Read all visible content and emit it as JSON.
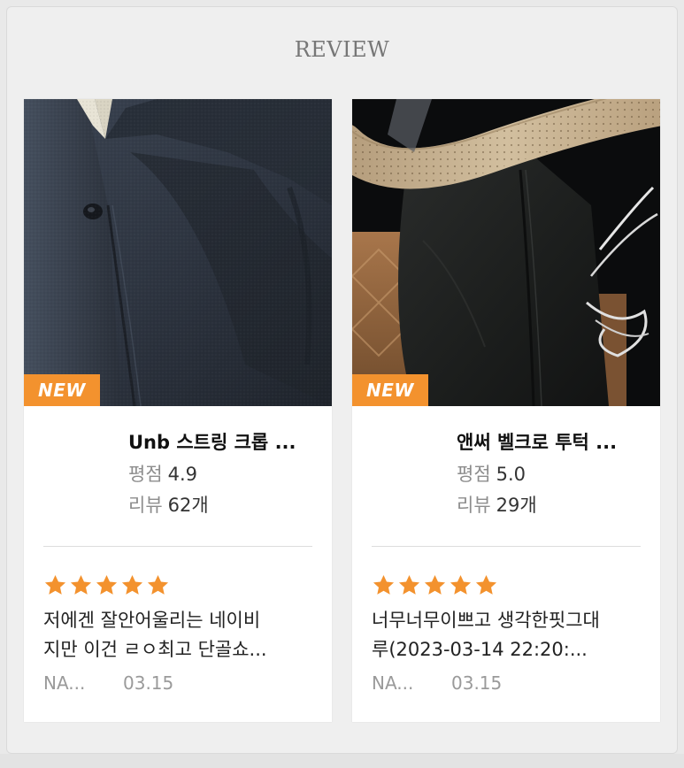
{
  "section": {
    "title": "REVIEW"
  },
  "colors": {
    "accent": "#f3922e",
    "star": "#f3922e",
    "background": "#efefef"
  },
  "cards": [
    {
      "badge": "NEW",
      "photo_alt": "navy cardigan",
      "product_name": "Unb 스트링 크롭 ...",
      "rating_label": "평점",
      "rating_value": "4.9",
      "review_label": "리뷰",
      "review_count": "62개",
      "stars": 5,
      "review_lines": [
        "저에겐 잘안어울리는 네이비",
        "지만 이건 ㄹㅇ최고 단골쇼..."
      ],
      "author": "NA...",
      "date": "03.15"
    },
    {
      "badge": "NEW",
      "photo_alt": "black slacks in car seat",
      "product_name": "앤써 벨크로 투턱 ...",
      "rating_label": "평점",
      "rating_value": "5.0",
      "review_label": "리뷰",
      "review_count": "29개",
      "stars": 5,
      "review_lines": [
        "너무너무이쁘고 생각한핏그대",
        "루(2023-03-14 22:20:..."
      ],
      "author": "NA...",
      "date": "03.15"
    }
  ]
}
